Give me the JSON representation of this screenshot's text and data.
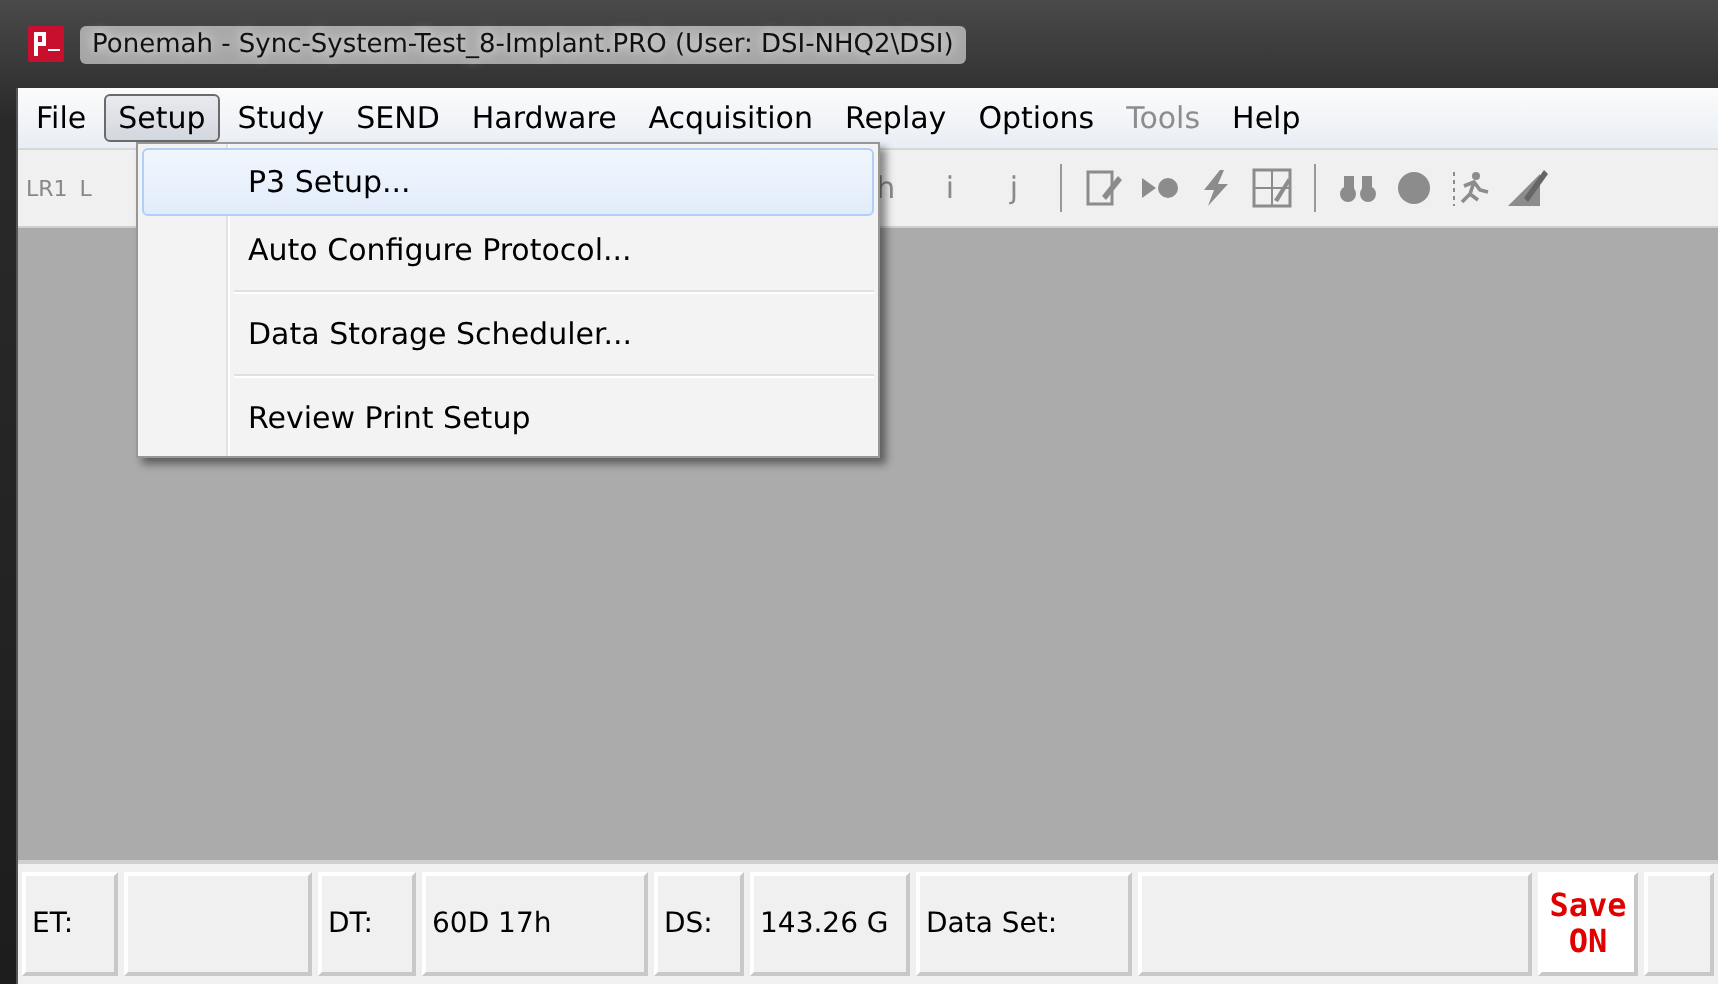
{
  "window": {
    "title": "Ponemah - Sync-System-Test_8-Implant.PRO (User: DSI-NHQ2\\DSI)"
  },
  "menu_bar": [
    {
      "label": "File",
      "selected": false,
      "disabled": false
    },
    {
      "label": "Setup",
      "selected": true,
      "disabled": false
    },
    {
      "label": "Study",
      "selected": false,
      "disabled": false
    },
    {
      "label": "SEND",
      "selected": false,
      "disabled": false
    },
    {
      "label": "Hardware",
      "selected": false,
      "disabled": false
    },
    {
      "label": "Acquisition",
      "selected": false,
      "disabled": false
    },
    {
      "label": "Replay",
      "selected": false,
      "disabled": false
    },
    {
      "label": "Options",
      "selected": false,
      "disabled": false
    },
    {
      "label": "Tools",
      "selected": false,
      "disabled": true
    },
    {
      "label": "Help",
      "selected": false,
      "disabled": false
    }
  ],
  "toolbar": {
    "left_labels": [
      "LR1",
      "L"
    ],
    "letter_buttons": [
      "h",
      "i",
      "j"
    ]
  },
  "setup_menu": [
    {
      "label": "P3 Setup...",
      "selected": true,
      "separator_after": false
    },
    {
      "label": "Auto Configure Protocol...",
      "selected": false,
      "separator_after": true
    },
    {
      "label": "Data Storage Scheduler...",
      "selected": false,
      "separator_after": true
    },
    {
      "label": "Review Print Setup",
      "selected": false,
      "separator_after": false
    }
  ],
  "status_bar": [
    {
      "kind": "label",
      "text": "ET:"
    },
    {
      "kind": "value"
    },
    {
      "kind": "label",
      "text": "DT:"
    },
    {
      "kind": "value",
      "text": "60D 17h"
    },
    {
      "kind": "label",
      "text": "DS:"
    },
    {
      "kind": "value",
      "text": "143.26 G"
    },
    {
      "kind": "label",
      "text": "Data Set:"
    },
    {
      "kind": "value"
    },
    {
      "kind": "alert",
      "text": "Save\nON"
    },
    {
      "kind": "value"
    }
  ]
}
